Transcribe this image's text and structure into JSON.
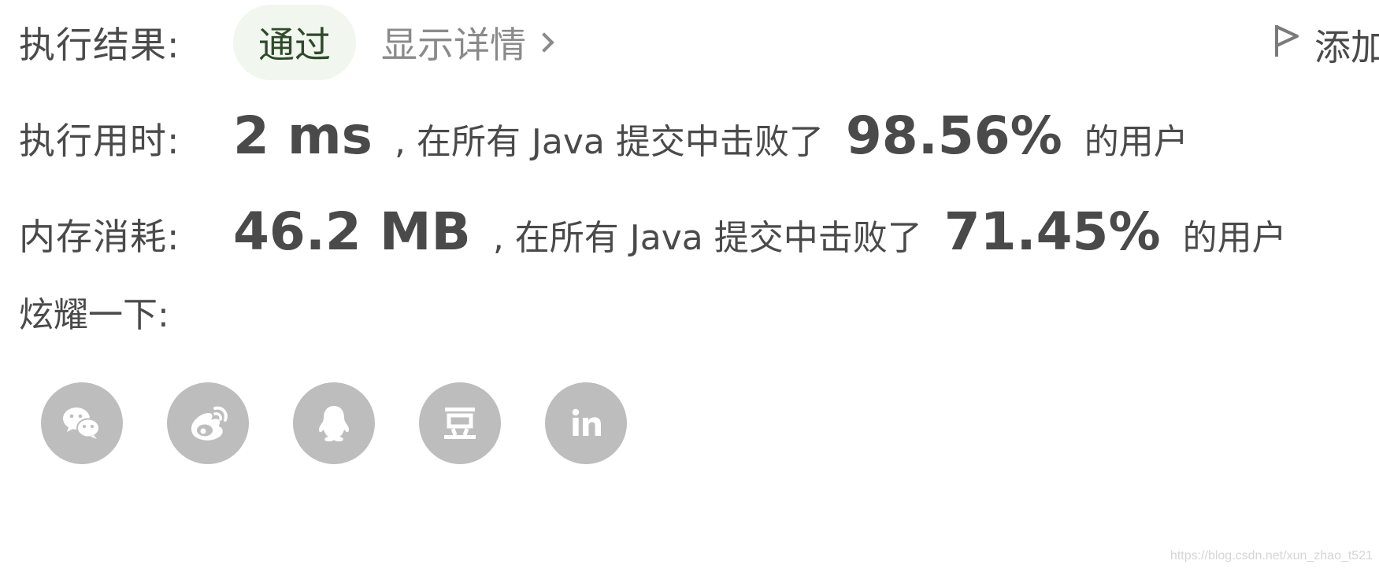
{
  "result": {
    "label": "执行结果:",
    "status": "通过",
    "details_link": "显示详情",
    "add_label": "添加"
  },
  "runtime": {
    "label": "执行用时:",
    "value": "2 ms",
    "beat_text": ", 在所有 Java 提交中击败了",
    "percent": "98.56%",
    "suffix": "的用户"
  },
  "memory": {
    "label": "内存消耗:",
    "value": "46.2 MB",
    "beat_text": ", 在所有 Java 提交中击败了",
    "percent": "71.45%",
    "suffix": "的用户"
  },
  "share": {
    "label": "炫耀一下:",
    "icons": [
      "wechat-icon",
      "weibo-icon",
      "qq-icon",
      "douban-icon",
      "linkedin-icon"
    ]
  },
  "watermark": "https://blog.csdn.net/xun_zhao_t521",
  "colors": {
    "status_bg": "#f1f6ee",
    "status_text": "#2e4a2b",
    "icon_bg": "#bdbdbd",
    "text": "#4a4a4a",
    "muted": "#8a8a8a"
  }
}
